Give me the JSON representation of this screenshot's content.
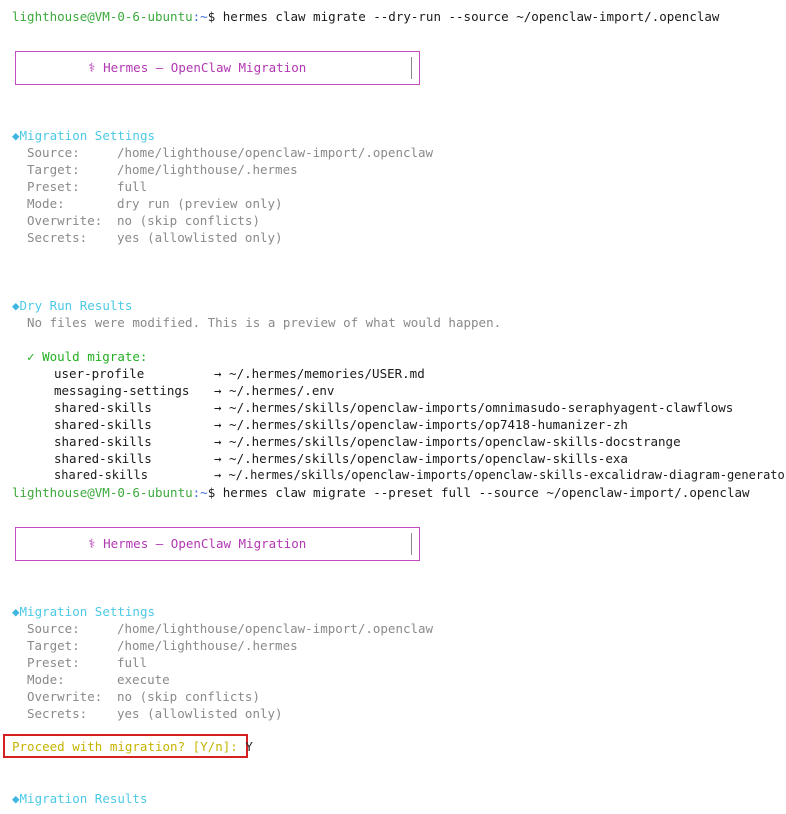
{
  "command1": {
    "user": "lighthouse@VM-0-6-ubuntu",
    "path": ":~",
    "text": "$ hermes claw migrate --dry-run --source ~/openclaw-import/.openclaw"
  },
  "banner": {
    "icon": "⚕",
    "title": "Hermes — OpenClaw Migration"
  },
  "settings_header": "Migration Settings",
  "settings1": [
    {
      "key": "Source:",
      "value": "/home/lighthouse/openclaw-import/.openclaw"
    },
    {
      "key": "Target:",
      "value": "/home/lighthouse/.hermes"
    },
    {
      "key": "Preset:",
      "value": "full"
    },
    {
      "key": "Mode:",
      "value": "dry run (preview only)"
    },
    {
      "key": "Overwrite:",
      "value": "no (skip conflicts)"
    },
    {
      "key": "Secrets:",
      "value": "yes (allowlisted only)"
    }
  ],
  "dry_run_header": "Dry Run Results",
  "dry_run_note": "No files were modified. This is a preview of what would happen.",
  "would_migrate": "Would migrate:",
  "migrate_items": [
    {
      "name": "user-profile",
      "dest": "→ ~/.hermes/memories/USER.md"
    },
    {
      "name": "messaging-settings",
      "dest": "→ ~/.hermes/.env"
    },
    {
      "name": "shared-skills",
      "dest": "→ ~/.hermes/skills/openclaw-imports/omnimasudo-seraphyagent-clawflows"
    },
    {
      "name": "shared-skills",
      "dest": "→ ~/.hermes/skills/openclaw-imports/op7418-humanizer-zh"
    },
    {
      "name": "shared-skills",
      "dest": "→ ~/.hermes/skills/openclaw-imports/openclaw-skills-docstrange"
    },
    {
      "name": "shared-skills",
      "dest": "→ ~/.hermes/skills/openclaw-imports/openclaw-skills-exa"
    },
    {
      "name": "shared-skills",
      "dest": "→ ~/.hermes/skills/openclaw-imports/openclaw-skills-excalidraw-diagram-generator"
    }
  ],
  "command2": {
    "user": "lighthouse@VM-0-6-ubuntu",
    "path": ":~",
    "text": "$ hermes claw migrate --preset full --source ~/openclaw-import/.openclaw"
  },
  "settings2": [
    {
      "key": "Source:",
      "value": "/home/lighthouse/openclaw-import/.openclaw"
    },
    {
      "key": "Target:",
      "value": "/home/lighthouse/.hermes"
    },
    {
      "key": "Preset:",
      "value": "full"
    },
    {
      "key": "Mode:",
      "value": "execute"
    },
    {
      "key": "Overwrite:",
      "value": "no (skip conflicts)"
    },
    {
      "key": "Secrets:",
      "value": "yes (allowlisted only)"
    }
  ],
  "proceed_prompt": "Proceed with migration? [Y/n]:",
  "proceed_answer": "Y",
  "results_header": "Migration Results",
  "colors": {
    "user": "#3daa3d",
    "path": "#3b6fd6",
    "header": "#4dc9e6",
    "check": "#22b022",
    "prompt": "#c6b400",
    "banner": "#b237b2",
    "highlight": "#d42020"
  }
}
